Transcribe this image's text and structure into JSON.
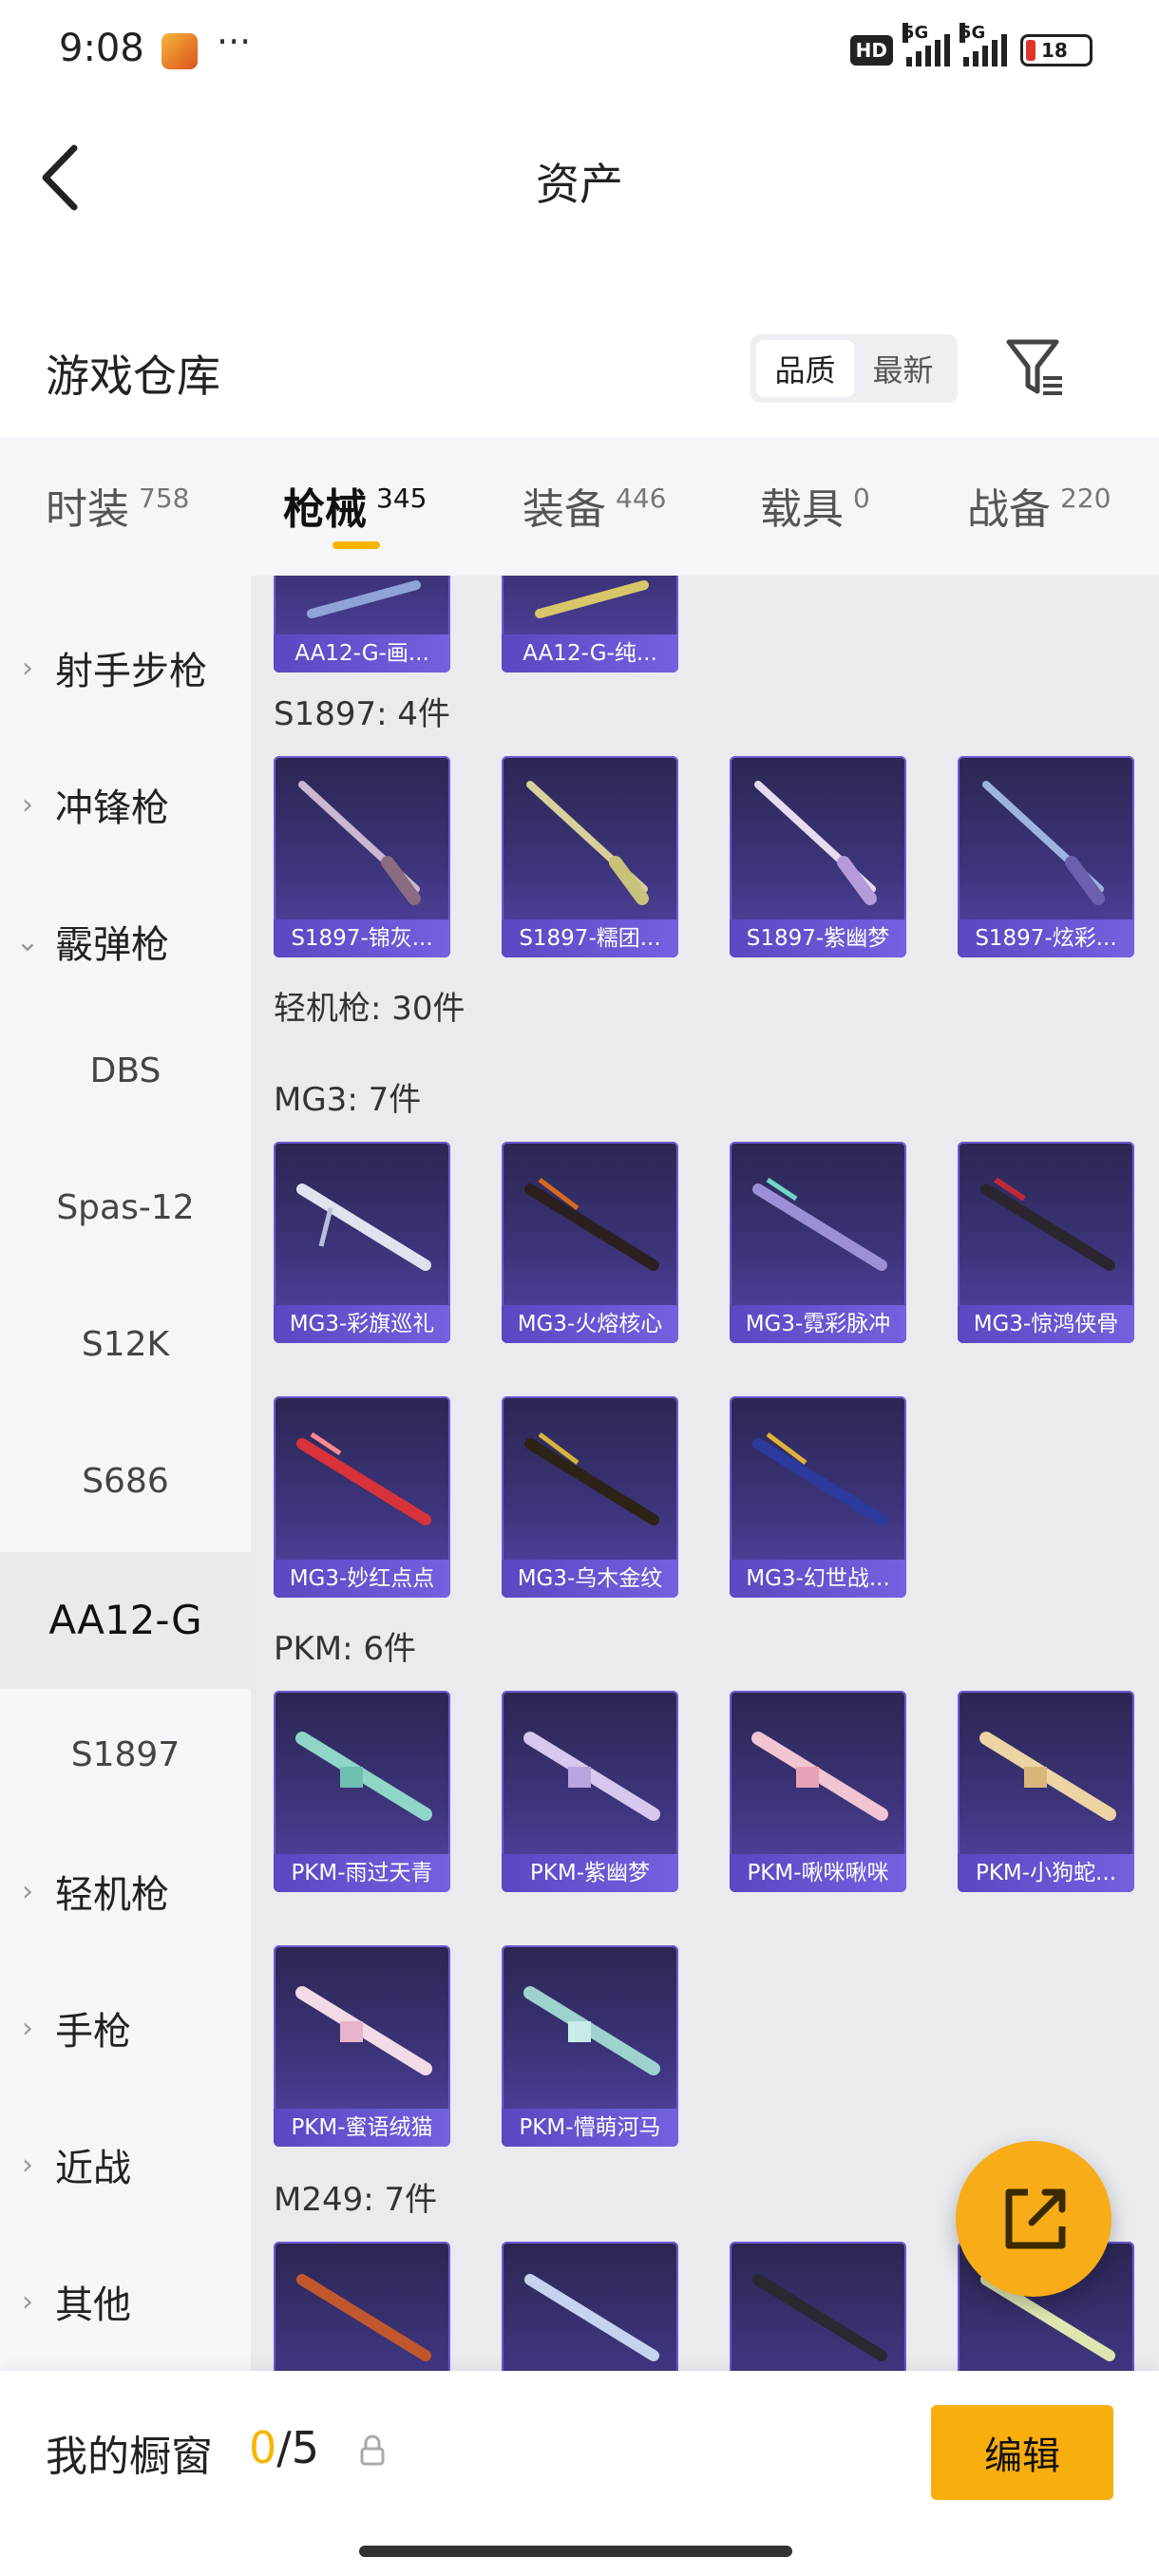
{
  "status_bar": {
    "time": "9:08",
    "dots": "···",
    "battery": "18",
    "hd": "HD",
    "net1": "5G",
    "net2": "5G"
  },
  "header": {
    "title": "资产"
  },
  "warehouse": {
    "title": "游戏仓库",
    "sort_quality": "品质",
    "sort_newest": "最新"
  },
  "tabs": [
    {
      "label": "时装",
      "count": "758"
    },
    {
      "label": "枪械",
      "count": "345"
    },
    {
      "label": "装备",
      "count": "446"
    },
    {
      "label": "载具",
      "count": "0"
    },
    {
      "label": "战备",
      "count": "220"
    }
  ],
  "sidebar": {
    "cat_sniper": "射手步枪",
    "cat_smg": "冲锋枪",
    "cat_shotgun": "霰弹枪",
    "sub_dbs": "DBS",
    "sub_spas12": "Spas-12",
    "sub_s12k": "S12K",
    "sub_s686": "S686",
    "sub_aa12g": "AA12-G",
    "sub_s1897": "S1897",
    "cat_lmg": "轻机枪",
    "cat_pistol": "手枪",
    "cat_melee": "近战",
    "cat_other": "其他"
  },
  "content": {
    "aa12_items": [
      "AA12-G-画...",
      "AA12-G-纯..."
    ],
    "s1897_header": "S1897: 4件",
    "s1897_items": [
      "S1897-锦灰...",
      "S1897-糯团...",
      "S1897-紫幽梦",
      "S1897-炫彩..."
    ],
    "lmg_header": "轻机枪: 30件",
    "mg3_header": "MG3: 7件",
    "mg3_items": [
      "MG3-彩旗巡礼",
      "MG3-火熔核心",
      "MG3-霓彩脉冲",
      "MG3-惊鸿侠骨",
      "MG3-妙红点点",
      "MG3-乌木金纹",
      "MG3-幻世战..."
    ],
    "pkm_header": "PKM: 6件",
    "pkm_items": [
      "PKM-雨过天青",
      "PKM-紫幽梦",
      "PKM-啾咪啾咪",
      "PKM-小狗蛇...",
      "PKM-蜜语绒猫",
      "PKM-懵萌河马"
    ],
    "m249_header": "M249: 7件"
  },
  "bottom": {
    "label": "我的橱窗",
    "count_used": "0",
    "count_total": "/5",
    "edit": "编辑"
  },
  "colors": {
    "accent": "#f7b500",
    "card_bg": "#3c347a",
    "card_label": "#6a5bd0"
  }
}
